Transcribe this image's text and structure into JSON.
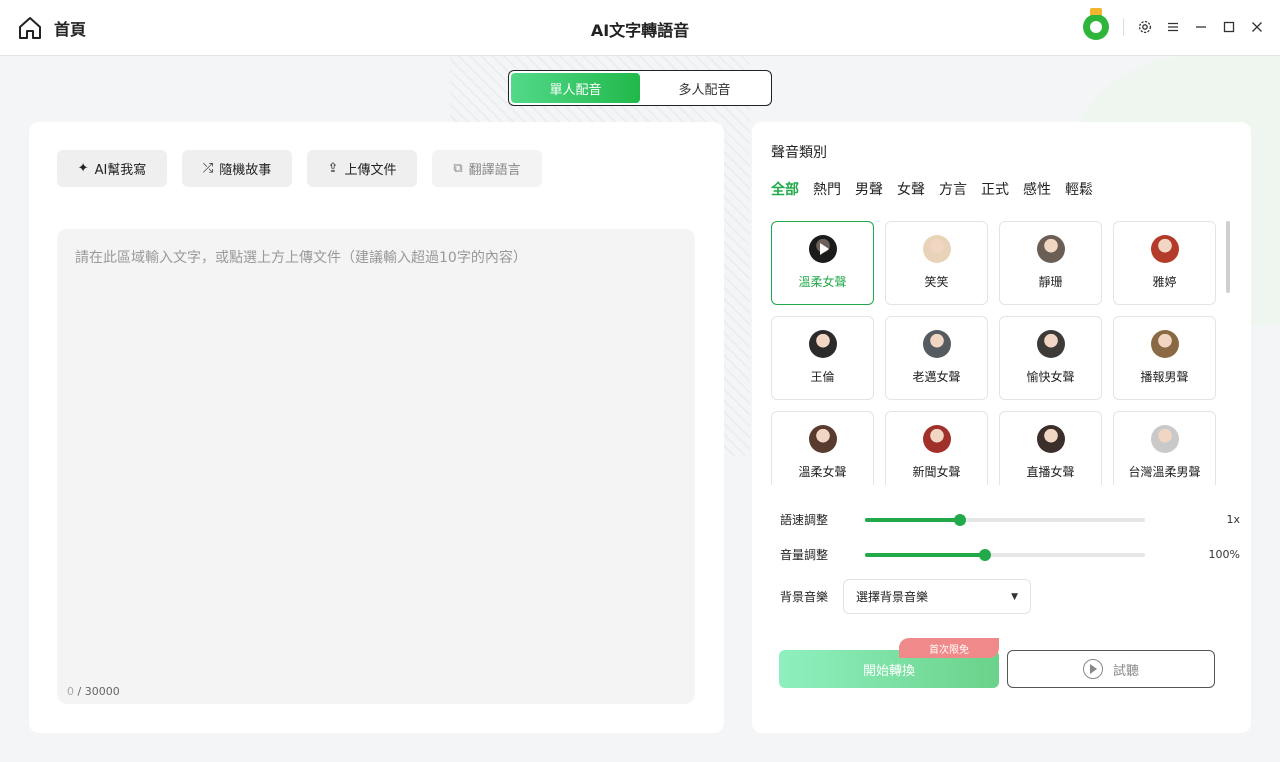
{
  "titlebar": {
    "home_label": "首頁",
    "title": "AI文字轉語音",
    "icons": [
      "home-icon",
      "avatar-icon",
      "gear-icon",
      "menu-icon",
      "minimize-icon",
      "maximize-icon",
      "close-icon"
    ]
  },
  "mode": {
    "tabs": [
      {
        "label": "單人配音",
        "active": true
      },
      {
        "label": "多人配音",
        "active": false
      }
    ]
  },
  "editor": {
    "tools": [
      {
        "label": "AI幫我寫",
        "icon": "magic-icon",
        "enabled": true
      },
      {
        "label": "隨機故事",
        "icon": "shuffle-icon",
        "enabled": true
      },
      {
        "label": "上傳文件",
        "icon": "upload-icon",
        "enabled": true
      },
      {
        "label": "翻譯語言",
        "icon": "translate-icon",
        "enabled": false
      }
    ],
    "placeholder": "請在此區域輸入文字，或點選上方上傳文件（建議輸入超過10字的內容）",
    "value": "",
    "count_current": "0",
    "count_max": " / 30000"
  },
  "voices": {
    "section_title": "聲音類別",
    "categories": [
      {
        "label": "全部",
        "active": true
      },
      {
        "label": "熱門",
        "active": false
      },
      {
        "label": "男聲",
        "active": false
      },
      {
        "label": "女聲",
        "active": false
      },
      {
        "label": "方言",
        "active": false
      },
      {
        "label": "正式",
        "active": false
      },
      {
        "label": "感性",
        "active": false
      },
      {
        "label": "輕鬆",
        "active": false
      }
    ],
    "items": [
      {
        "name": "溫柔女聲",
        "active": true,
        "color": "#3d3d3d"
      },
      {
        "name": "笑笑",
        "active": false,
        "color": "#e8d3b8"
      },
      {
        "name": "靜珊",
        "active": false,
        "color": "#6b5e55"
      },
      {
        "name": "雅婷",
        "active": false,
        "color": "#b43a2a"
      },
      {
        "name": "王倫",
        "active": false,
        "color": "#2b2b2b"
      },
      {
        "name": "老邁女聲",
        "active": false,
        "color": "#555b60"
      },
      {
        "name": "愉快女聲",
        "active": false,
        "color": "#3e3a37"
      },
      {
        "name": "播報男聲",
        "active": false,
        "color": "#8a6a44"
      },
      {
        "name": "溫柔女聲",
        "active": false,
        "color": "#5a3b2f"
      },
      {
        "name": "新聞女聲",
        "active": false,
        "color": "#a12f2a"
      },
      {
        "name": "直播女聲",
        "active": false,
        "color": "#3c2e2a"
      },
      {
        "name": "台灣溫柔男聲",
        "active": false,
        "color": "#c9c9c9"
      }
    ]
  },
  "settings": {
    "speed": {
      "label": "語速調整",
      "value_text": "1x",
      "fraction": 0.34
    },
    "volume": {
      "label": "音量調整",
      "value_text": "100%",
      "fraction": 0.43
    },
    "bgm": {
      "label": "背景音樂",
      "selected": "選擇背景音樂"
    }
  },
  "actions": {
    "convert_label": "開始轉換",
    "free_badge": "首次限免",
    "preview_label": "試聽"
  }
}
